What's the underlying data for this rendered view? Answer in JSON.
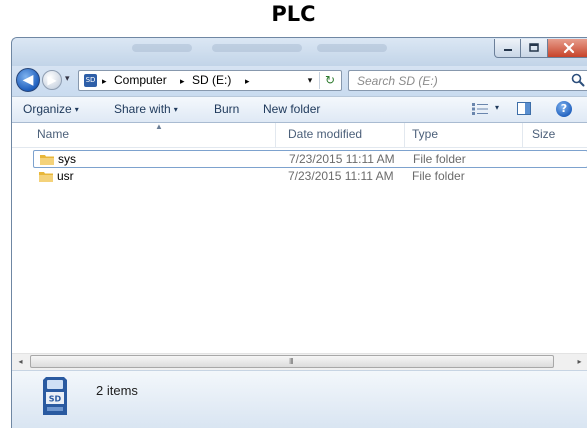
{
  "caption": "PLC",
  "window": {
    "controls": {
      "minimize": "–",
      "maximize": "□",
      "close": "x"
    }
  },
  "nav": {
    "back_glyph": "◀",
    "forward_glyph": "▶",
    "recent_glyph": "▾"
  },
  "address": {
    "drive_badge": "SD",
    "crumbs": [
      "Computer",
      "SD (E:)"
    ],
    "separator": "▸",
    "dropdown_glyph": "▾",
    "refresh_glyph": "↻"
  },
  "search": {
    "placeholder": "Search SD (E:)",
    "icon": "magnifier-icon"
  },
  "toolbar": {
    "organize": "Organize",
    "share_with": "Share with",
    "burn": "Burn",
    "new_folder": "New folder",
    "caret": "▾",
    "help_glyph": "?"
  },
  "columns": {
    "name": "Name",
    "date_modified": "Date modified",
    "type": "Type",
    "size": "Size"
  },
  "files": [
    {
      "name": "sys",
      "date_modified": "7/23/2015 11:11 AM",
      "type": "File folder",
      "size": ""
    },
    {
      "name": "usr",
      "date_modified": "7/23/2015 11:11 AM",
      "type": "File folder",
      "size": ""
    }
  ],
  "scrollbar": {
    "left_arrow": "◂",
    "right_arrow": "▸",
    "grip": "III"
  },
  "status": {
    "item_count": "2 items"
  },
  "colors": {
    "accent": "#1f5fbd",
    "close_red": "#c7442b",
    "folder": "#e8b73a",
    "toolbar_text": "#1e395b"
  }
}
